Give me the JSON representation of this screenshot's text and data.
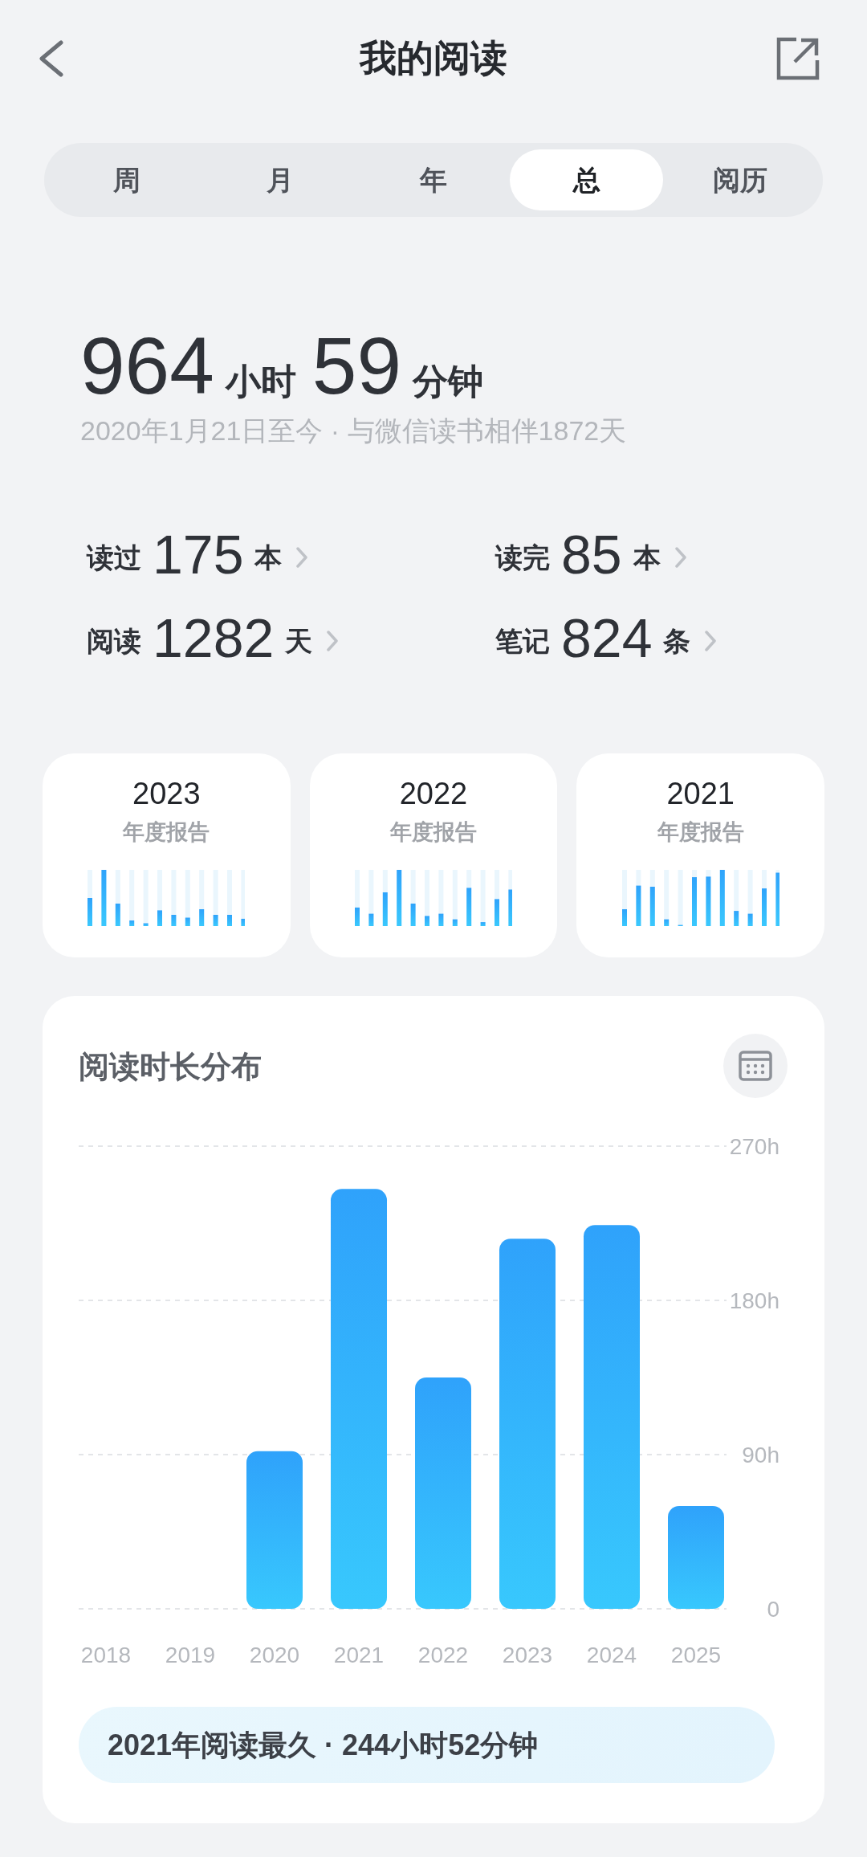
{
  "header": {
    "title": "我的阅读"
  },
  "tabs": [
    {
      "label": "周",
      "selected": false
    },
    {
      "label": "月",
      "selected": false
    },
    {
      "label": "年",
      "selected": false
    },
    {
      "label": "总",
      "selected": true
    },
    {
      "label": "阅历",
      "selected": false
    }
  ],
  "total": {
    "hours": "964",
    "hours_unit": "小时",
    "minutes": "59",
    "minutes_unit": "分钟",
    "since": "2020年1月21日至今 · 与微信读书相伴1872天"
  },
  "stats": [
    {
      "label": "读过",
      "value": "175",
      "unit": "本"
    },
    {
      "label": "读完",
      "value": "85",
      "unit": "本"
    },
    {
      "label": "阅读",
      "value": "1282",
      "unit": "天"
    },
    {
      "label": "笔记",
      "value": "824",
      "unit": "条"
    }
  ],
  "annual_reports": [
    {
      "year": "2023",
      "label": "年度报告"
    },
    {
      "year": "2022",
      "label": "年度报告"
    },
    {
      "year": "2021",
      "label": "年度报告"
    }
  ],
  "distribution": {
    "title": "阅读时长分布",
    "chart_data": {
      "type": "bar",
      "categories": [
        "2018",
        "2019",
        "2020",
        "2021",
        "2022",
        "2023",
        "2024",
        "2025"
      ],
      "series": [
        {
          "values": [
            0,
            0,
            92,
            245,
            135,
            216,
            224,
            60
          ]
        }
      ],
      "ylim": [
        0,
        270
      ],
      "yticks": [
        {
          "value": 0,
          "label": "0"
        },
        {
          "value": 90,
          "label": "90h"
        },
        {
          "value": 180,
          "label": "180h"
        },
        {
          "value": 270,
          "label": "270h"
        }
      ]
    },
    "summary": "2021年阅读最久 · 244小时52分钟"
  }
}
